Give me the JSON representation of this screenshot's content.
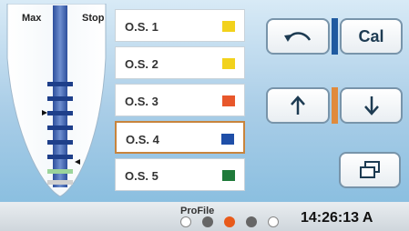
{
  "gauge": {
    "max_label": "Max",
    "stop_label": "Stop"
  },
  "os_list": [
    {
      "label": "O.S. 1",
      "color": "#f2d21c"
    },
    {
      "label": "O.S. 2",
      "color": "#f2d21c"
    },
    {
      "label": "O.S. 3",
      "color": "#e8572b"
    },
    {
      "label": "O.S. 4",
      "color": "#1f4fa8",
      "selected": true
    },
    {
      "label": "O.S. 5",
      "color": "#1f7a3a"
    }
  ],
  "buttons": {
    "back_icon": "undo-arrow-icon",
    "cal_label": "Cal",
    "up_icon": "arrow-up-icon",
    "down_icon": "arrow-down-icon",
    "window_icon": "window-restore-icon"
  },
  "status": {
    "brand": "ProFile",
    "time": "14:26:13",
    "suffix": "A",
    "dots": [
      {
        "state": "empty",
        "color": "#ffffff"
      },
      {
        "state": "filled",
        "color": "#666666"
      },
      {
        "state": "active",
        "color": "#e85a1a"
      },
      {
        "state": "filled",
        "color": "#666666"
      },
      {
        "state": "empty",
        "color": "#ffffff"
      }
    ]
  }
}
